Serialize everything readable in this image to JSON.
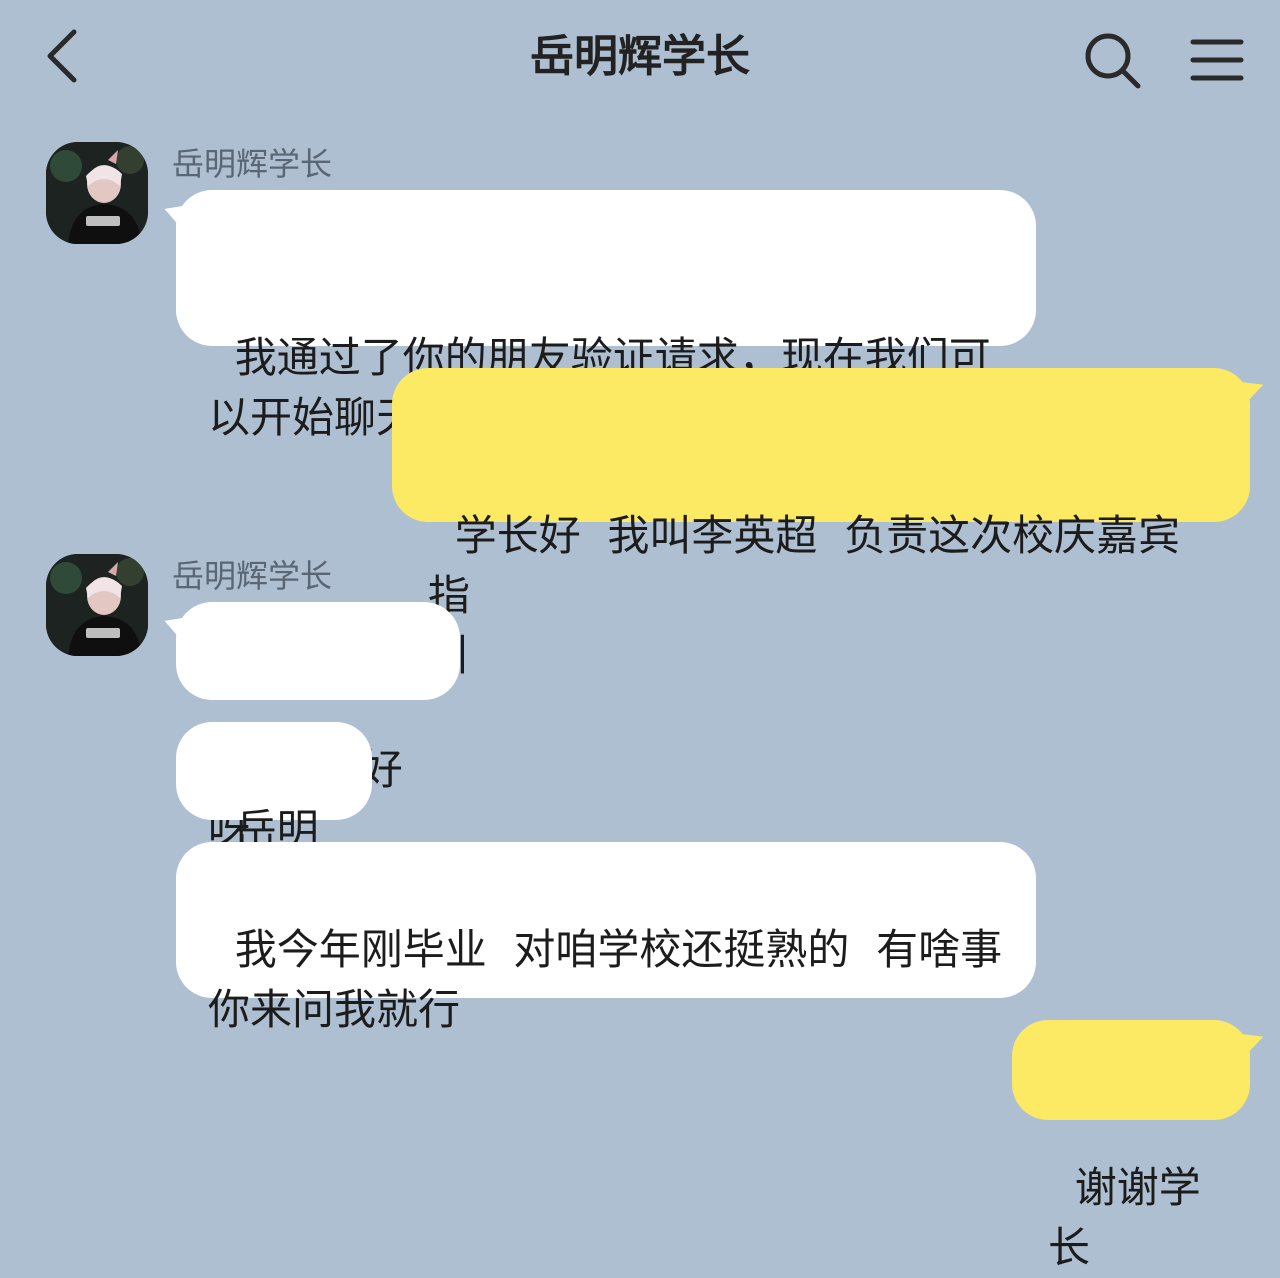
{
  "header": {
    "title": "岳明辉学长",
    "back_icon": "chevron-left-icon",
    "search_icon": "search-icon",
    "menu_icon": "hamburger-menu-icon"
  },
  "colors": {
    "background": "#adbfd1",
    "incoming_bubble": "#ffffff",
    "outgoing_bubble": "#fce964"
  },
  "messages": [
    {
      "direction": "incoming",
      "sender": "岳明辉学长",
      "text": "我通过了你的朋友验证请求，现在我们可\n以开始聊天了"
    },
    {
      "direction": "outgoing",
      "text": "学长好  我叫李英超  负责这次校庆嘉宾指\n引"
    },
    {
      "direction": "incoming",
      "sender": "岳明辉学长",
      "text": "你好你好呀"
    },
    {
      "direction": "incoming",
      "text": "岳明辉"
    },
    {
      "direction": "incoming",
      "text": "我今年刚毕业  对咱学校还挺熟的  有啥事\n你来问我就行"
    },
    {
      "direction": "outgoing",
      "text": "谢谢学长"
    }
  ]
}
